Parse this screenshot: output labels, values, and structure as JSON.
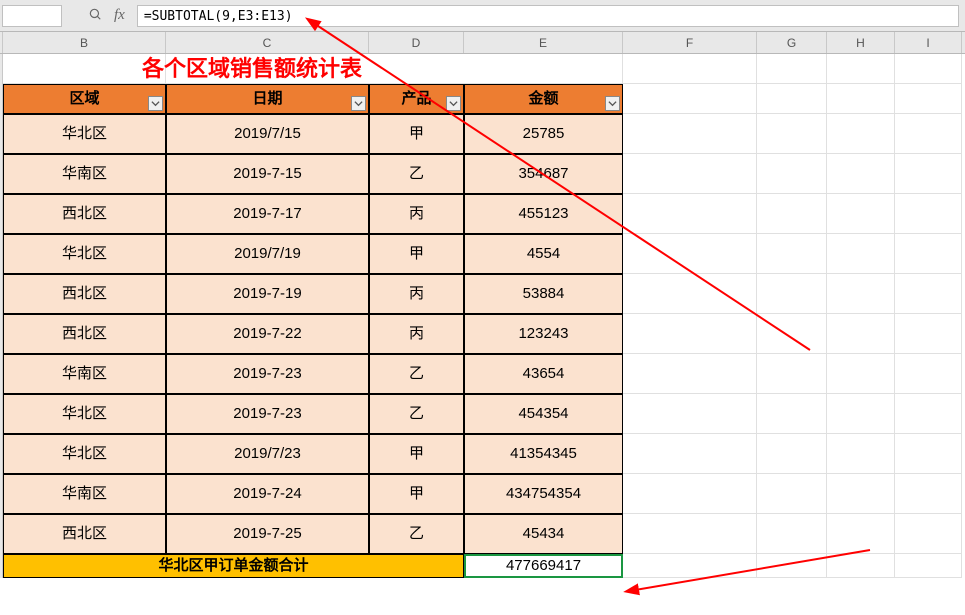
{
  "formula_bar": {
    "formula": "=SUBTOTAL(9,E3:E13)"
  },
  "columns": {
    "B": "B",
    "C": "C",
    "D": "D",
    "E": "E",
    "F": "F",
    "G": "G",
    "H": "H",
    "I": "I"
  },
  "title": "各个区域销售额统计表",
  "headers": {
    "region": "区域",
    "date": "日期",
    "product": "产品",
    "amount": "金额"
  },
  "rows": [
    {
      "region": "华北区",
      "date": "2019/7/15",
      "product": "甲",
      "amount": "25785"
    },
    {
      "region": "华南区",
      "date": "2019-7-15",
      "product": "乙",
      "amount": "354687"
    },
    {
      "region": "西北区",
      "date": "2019-7-17",
      "product": "丙",
      "amount": "455123"
    },
    {
      "region": "华北区",
      "date": "2019/7/19",
      "product": "甲",
      "amount": "4554"
    },
    {
      "region": "西北区",
      "date": "2019-7-19",
      "product": "丙",
      "amount": "53884"
    },
    {
      "region": "西北区",
      "date": "2019-7-22",
      "product": "丙",
      "amount": "123243"
    },
    {
      "region": "华南区",
      "date": "2019-7-23",
      "product": "乙",
      "amount": "43654"
    },
    {
      "region": "华北区",
      "date": "2019-7-23",
      "product": "乙",
      "amount": "454354"
    },
    {
      "region": "华北区",
      "date": "2019/7/23",
      "product": "甲",
      "amount": "41354345"
    },
    {
      "region": "华南区",
      "date": "2019-7-24",
      "product": "甲",
      "amount": "434754354"
    },
    {
      "region": "西北区",
      "date": "2019-7-25",
      "product": "乙",
      "amount": "45434"
    }
  ],
  "summary": {
    "label": "华北区甲订单金额合计",
    "value": "477669417"
  }
}
